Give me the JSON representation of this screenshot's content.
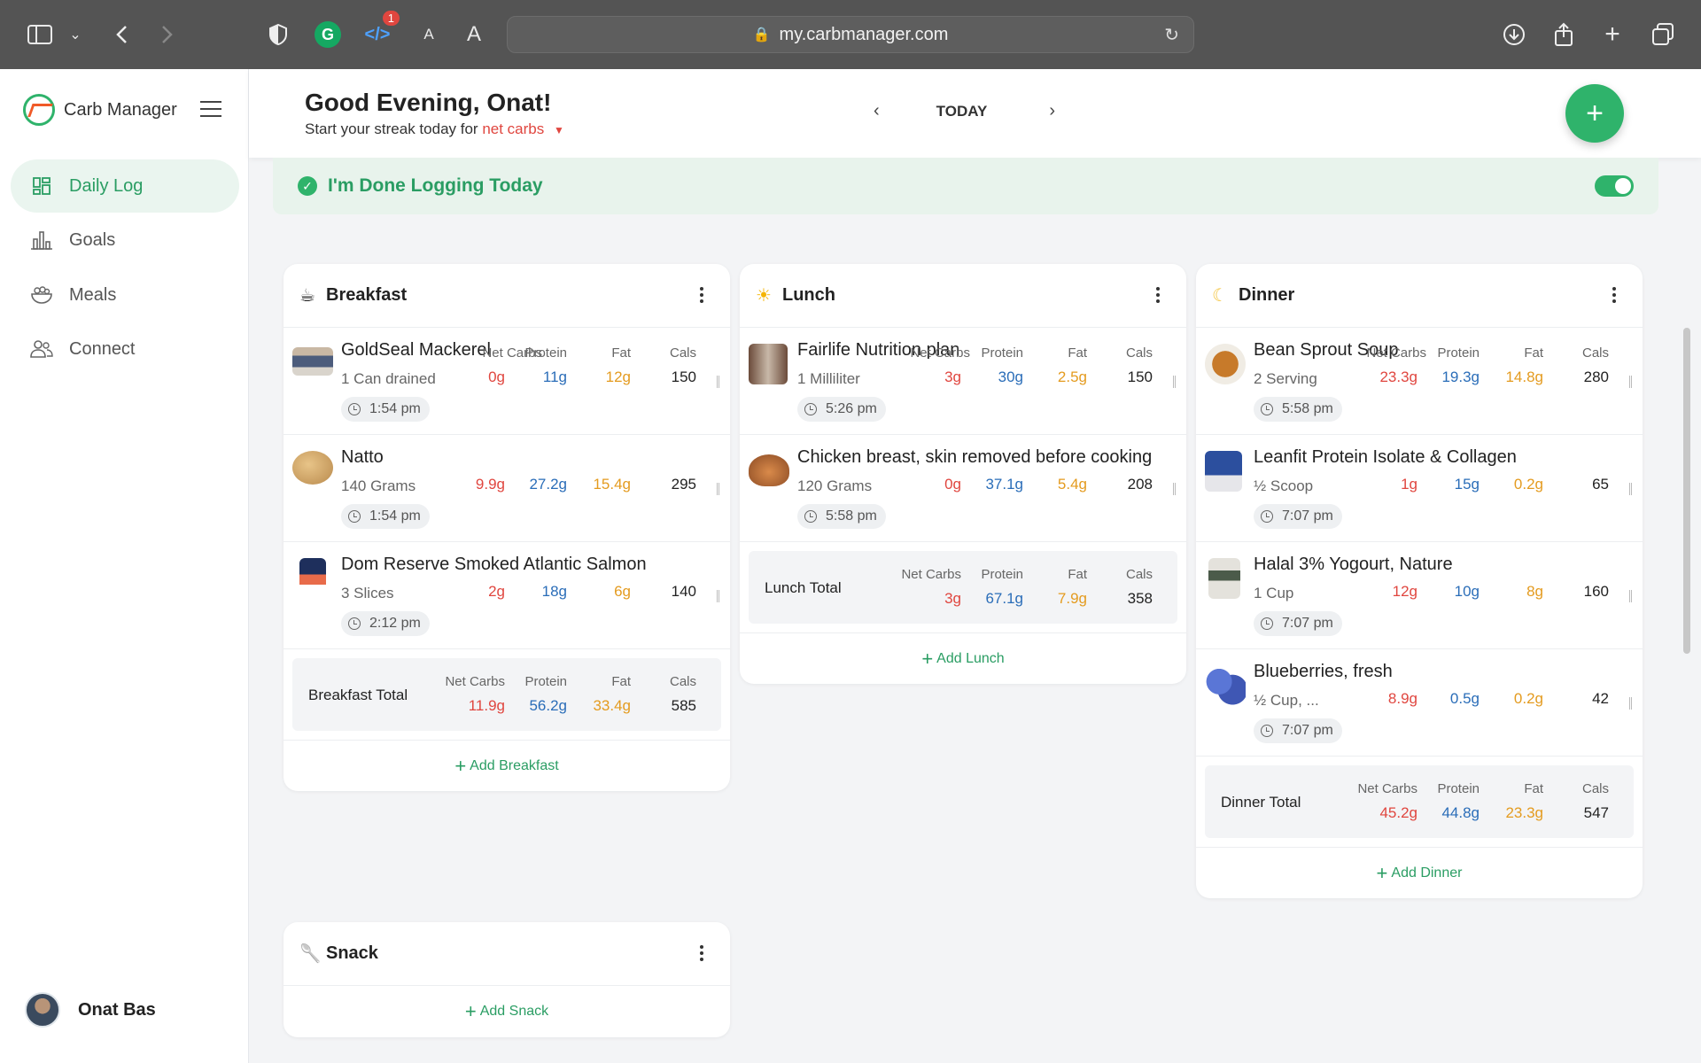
{
  "browser": {
    "url": "my.carbmanager.com",
    "extension_badge": "1",
    "font_small": "A",
    "font_large": "A"
  },
  "sidebar": {
    "brand": "Carb Manager",
    "items": [
      {
        "label": "Daily Log",
        "icon": "dashboard-icon",
        "active": true
      },
      {
        "label": "Goals",
        "icon": "bar-chart-icon",
        "active": false
      },
      {
        "label": "Meals",
        "icon": "bowl-icon",
        "active": false
      },
      {
        "label": "Connect",
        "icon": "people-icon",
        "active": false
      }
    ],
    "user_name": "Onat Bas"
  },
  "header": {
    "greeting": "Good Evening, Onat!",
    "streak_prefix": "Start your streak today for",
    "streak_metric": "net carbs",
    "day_label": "TODAY"
  },
  "done_logging": {
    "label": "I'm Done Logging Today",
    "enabled": true
  },
  "columns": {
    "net_carbs": "Net Carbs",
    "protein": "Protein",
    "fat": "Fat",
    "cals": "Cals"
  },
  "meals": {
    "breakfast": {
      "title": "Breakfast",
      "items": [
        {
          "name": "GoldSeal Mackerel",
          "qty": "1 Can drained",
          "time": "1:54 pm",
          "carbs": "0g",
          "protein": "11g",
          "fat": "12g",
          "cals": "150"
        },
        {
          "name": "Natto",
          "qty": "140 Grams",
          "time": "1:54 pm",
          "carbs": "9.9g",
          "protein": "27.2g",
          "fat": "15.4g",
          "cals": "295"
        },
        {
          "name": "Dom Reserve Smoked Atlantic Salmon",
          "qty": "3 Slices",
          "time": "2:12 pm",
          "carbs": "2g",
          "protein": "18g",
          "fat": "6g",
          "cals": "140"
        }
      ],
      "total": {
        "label": "Breakfast Total",
        "carbs": "11.9g",
        "protein": "56.2g",
        "fat": "33.4g",
        "cals": "585"
      },
      "add_label": "Add Breakfast"
    },
    "lunch": {
      "title": "Lunch",
      "items": [
        {
          "name": "Fairlife Nutrition plan",
          "qty": "1 Milliliter",
          "time": "5:26 pm",
          "carbs": "3g",
          "protein": "30g",
          "fat": "2.5g",
          "cals": "150"
        },
        {
          "name": "Chicken breast, skin removed before cooking",
          "qty": "120 Grams",
          "time": "5:58 pm",
          "carbs": "0g",
          "protein": "37.1g",
          "fat": "5.4g",
          "cals": "208"
        }
      ],
      "total": {
        "label": "Lunch Total",
        "carbs": "3g",
        "protein": "67.1g",
        "fat": "7.9g",
        "cals": "358"
      },
      "add_label": "Add Lunch"
    },
    "dinner": {
      "title": "Dinner",
      "items": [
        {
          "name": "Bean Sprout Soup",
          "qty": "2 Serving",
          "time": "5:58 pm",
          "carbs": "23.3g",
          "protein": "19.3g",
          "fat": "14.8g",
          "cals": "280"
        },
        {
          "name": "Leanfit Protein Isolate & Collagen",
          "qty": "½ Scoop",
          "time": "7:07 pm",
          "carbs": "1g",
          "protein": "15g",
          "fat": "0.2g",
          "cals": "65"
        },
        {
          "name": "Halal 3% Yogourt, Nature",
          "qty": "1 Cup",
          "time": "7:07 pm",
          "carbs": "12g",
          "protein": "10g",
          "fat": "8g",
          "cals": "160"
        },
        {
          "name": "Blueberries, fresh",
          "qty": "½ Cup, ...",
          "time": "7:07 pm",
          "carbs": "8.9g",
          "protein": "0.5g",
          "fat": "0.2g",
          "cals": "42"
        }
      ],
      "total": {
        "label": "Dinner Total",
        "carbs": "45.2g",
        "protein": "44.8g",
        "fat": "23.3g",
        "cals": "547"
      },
      "add_label": "Add Dinner"
    },
    "snack": {
      "title": "Snack",
      "add_label": "Add Snack"
    }
  },
  "colors": {
    "brand_green": "#2fb36b",
    "net_carbs": "#e0463f",
    "protein": "#2a6db8",
    "fat": "#e49b1f"
  }
}
